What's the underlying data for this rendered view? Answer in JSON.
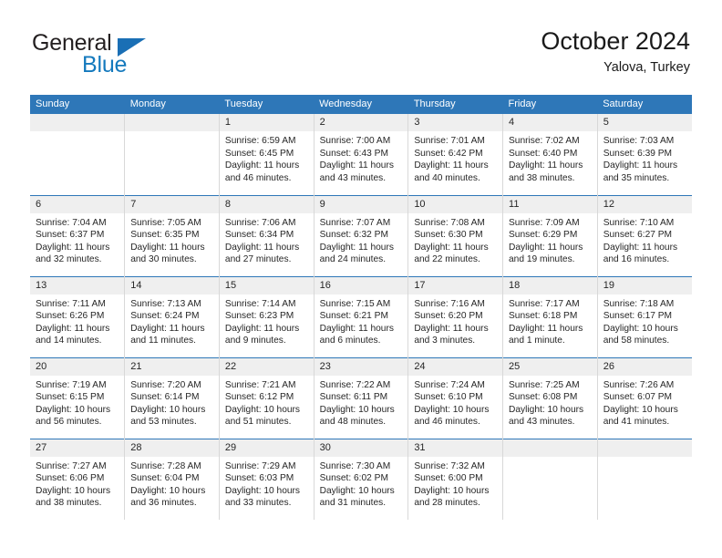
{
  "brand": {
    "name_part1": "General",
    "name_part2": "Blue",
    "logo_icon": "triangle-logo-icon",
    "accent_color": "#1479bd"
  },
  "header": {
    "title": "October 2024",
    "subtitle": "Yalova, Turkey"
  },
  "theme": {
    "header_blue": "#2e77b8",
    "date_band_gray": "#efefef",
    "text_color": "#262626"
  },
  "weekday_headers": [
    "Sunday",
    "Monday",
    "Tuesday",
    "Wednesday",
    "Thursday",
    "Friday",
    "Saturday"
  ],
  "weeks": [
    [
      {
        "day": "",
        "empty": true,
        "sunrise": "",
        "sunset": "",
        "daylight_line1": "",
        "daylight_line2": ""
      },
      {
        "day": "",
        "empty": true,
        "sunrise": "",
        "sunset": "",
        "daylight_line1": "",
        "daylight_line2": ""
      },
      {
        "day": "1",
        "sunrise": "Sunrise: 6:59 AM",
        "sunset": "Sunset: 6:45 PM",
        "daylight_line1": "Daylight: 11 hours",
        "daylight_line2": "and 46 minutes."
      },
      {
        "day": "2",
        "sunrise": "Sunrise: 7:00 AM",
        "sunset": "Sunset: 6:43 PM",
        "daylight_line1": "Daylight: 11 hours",
        "daylight_line2": "and 43 minutes."
      },
      {
        "day": "3",
        "sunrise": "Sunrise: 7:01 AM",
        "sunset": "Sunset: 6:42 PM",
        "daylight_line1": "Daylight: 11 hours",
        "daylight_line2": "and 40 minutes."
      },
      {
        "day": "4",
        "sunrise": "Sunrise: 7:02 AM",
        "sunset": "Sunset: 6:40 PM",
        "daylight_line1": "Daylight: 11 hours",
        "daylight_line2": "and 38 minutes."
      },
      {
        "day": "5",
        "sunrise": "Sunrise: 7:03 AM",
        "sunset": "Sunset: 6:39 PM",
        "daylight_line1": "Daylight: 11 hours",
        "daylight_line2": "and 35 minutes."
      }
    ],
    [
      {
        "day": "6",
        "sunrise": "Sunrise: 7:04 AM",
        "sunset": "Sunset: 6:37 PM",
        "daylight_line1": "Daylight: 11 hours",
        "daylight_line2": "and 32 minutes."
      },
      {
        "day": "7",
        "sunrise": "Sunrise: 7:05 AM",
        "sunset": "Sunset: 6:35 PM",
        "daylight_line1": "Daylight: 11 hours",
        "daylight_line2": "and 30 minutes."
      },
      {
        "day": "8",
        "sunrise": "Sunrise: 7:06 AM",
        "sunset": "Sunset: 6:34 PM",
        "daylight_line1": "Daylight: 11 hours",
        "daylight_line2": "and 27 minutes."
      },
      {
        "day": "9",
        "sunrise": "Sunrise: 7:07 AM",
        "sunset": "Sunset: 6:32 PM",
        "daylight_line1": "Daylight: 11 hours",
        "daylight_line2": "and 24 minutes."
      },
      {
        "day": "10",
        "sunrise": "Sunrise: 7:08 AM",
        "sunset": "Sunset: 6:30 PM",
        "daylight_line1": "Daylight: 11 hours",
        "daylight_line2": "and 22 minutes."
      },
      {
        "day": "11",
        "sunrise": "Sunrise: 7:09 AM",
        "sunset": "Sunset: 6:29 PM",
        "daylight_line1": "Daylight: 11 hours",
        "daylight_line2": "and 19 minutes."
      },
      {
        "day": "12",
        "sunrise": "Sunrise: 7:10 AM",
        "sunset": "Sunset: 6:27 PM",
        "daylight_line1": "Daylight: 11 hours",
        "daylight_line2": "and 16 minutes."
      }
    ],
    [
      {
        "day": "13",
        "sunrise": "Sunrise: 7:11 AM",
        "sunset": "Sunset: 6:26 PM",
        "daylight_line1": "Daylight: 11 hours",
        "daylight_line2": "and 14 minutes."
      },
      {
        "day": "14",
        "sunrise": "Sunrise: 7:13 AM",
        "sunset": "Sunset: 6:24 PM",
        "daylight_line1": "Daylight: 11 hours",
        "daylight_line2": "and 11 minutes."
      },
      {
        "day": "15",
        "sunrise": "Sunrise: 7:14 AM",
        "sunset": "Sunset: 6:23 PM",
        "daylight_line1": "Daylight: 11 hours",
        "daylight_line2": "and 9 minutes."
      },
      {
        "day": "16",
        "sunrise": "Sunrise: 7:15 AM",
        "sunset": "Sunset: 6:21 PM",
        "daylight_line1": "Daylight: 11 hours",
        "daylight_line2": "and 6 minutes."
      },
      {
        "day": "17",
        "sunrise": "Sunrise: 7:16 AM",
        "sunset": "Sunset: 6:20 PM",
        "daylight_line1": "Daylight: 11 hours",
        "daylight_line2": "and 3 minutes."
      },
      {
        "day": "18",
        "sunrise": "Sunrise: 7:17 AM",
        "sunset": "Sunset: 6:18 PM",
        "daylight_line1": "Daylight: 11 hours",
        "daylight_line2": "and 1 minute."
      },
      {
        "day": "19",
        "sunrise": "Sunrise: 7:18 AM",
        "sunset": "Sunset: 6:17 PM",
        "daylight_line1": "Daylight: 10 hours",
        "daylight_line2": "and 58 minutes."
      }
    ],
    [
      {
        "day": "20",
        "sunrise": "Sunrise: 7:19 AM",
        "sunset": "Sunset: 6:15 PM",
        "daylight_line1": "Daylight: 10 hours",
        "daylight_line2": "and 56 minutes."
      },
      {
        "day": "21",
        "sunrise": "Sunrise: 7:20 AM",
        "sunset": "Sunset: 6:14 PM",
        "daylight_line1": "Daylight: 10 hours",
        "daylight_line2": "and 53 minutes."
      },
      {
        "day": "22",
        "sunrise": "Sunrise: 7:21 AM",
        "sunset": "Sunset: 6:12 PM",
        "daylight_line1": "Daylight: 10 hours",
        "daylight_line2": "and 51 minutes."
      },
      {
        "day": "23",
        "sunrise": "Sunrise: 7:22 AM",
        "sunset": "Sunset: 6:11 PM",
        "daylight_line1": "Daylight: 10 hours",
        "daylight_line2": "and 48 minutes."
      },
      {
        "day": "24",
        "sunrise": "Sunrise: 7:24 AM",
        "sunset": "Sunset: 6:10 PM",
        "daylight_line1": "Daylight: 10 hours",
        "daylight_line2": "and 46 minutes."
      },
      {
        "day": "25",
        "sunrise": "Sunrise: 7:25 AM",
        "sunset": "Sunset: 6:08 PM",
        "daylight_line1": "Daylight: 10 hours",
        "daylight_line2": "and 43 minutes."
      },
      {
        "day": "26",
        "sunrise": "Sunrise: 7:26 AM",
        "sunset": "Sunset: 6:07 PM",
        "daylight_line1": "Daylight: 10 hours",
        "daylight_line2": "and 41 minutes."
      }
    ],
    [
      {
        "day": "27",
        "sunrise": "Sunrise: 7:27 AM",
        "sunset": "Sunset: 6:06 PM",
        "daylight_line1": "Daylight: 10 hours",
        "daylight_line2": "and 38 minutes."
      },
      {
        "day": "28",
        "sunrise": "Sunrise: 7:28 AM",
        "sunset": "Sunset: 6:04 PM",
        "daylight_line1": "Daylight: 10 hours",
        "daylight_line2": "and 36 minutes."
      },
      {
        "day": "29",
        "sunrise": "Sunrise: 7:29 AM",
        "sunset": "Sunset: 6:03 PM",
        "daylight_line1": "Daylight: 10 hours",
        "daylight_line2": "and 33 minutes."
      },
      {
        "day": "30",
        "sunrise": "Sunrise: 7:30 AM",
        "sunset": "Sunset: 6:02 PM",
        "daylight_line1": "Daylight: 10 hours",
        "daylight_line2": "and 31 minutes."
      },
      {
        "day": "31",
        "sunrise": "Sunrise: 7:32 AM",
        "sunset": "Sunset: 6:00 PM",
        "daylight_line1": "Daylight: 10 hours",
        "daylight_line2": "and 28 minutes."
      },
      {
        "day": "",
        "empty": true,
        "sunrise": "",
        "sunset": "",
        "daylight_line1": "",
        "daylight_line2": ""
      },
      {
        "day": "",
        "empty": true,
        "sunrise": "",
        "sunset": "",
        "daylight_line1": "",
        "daylight_line2": ""
      }
    ]
  ]
}
